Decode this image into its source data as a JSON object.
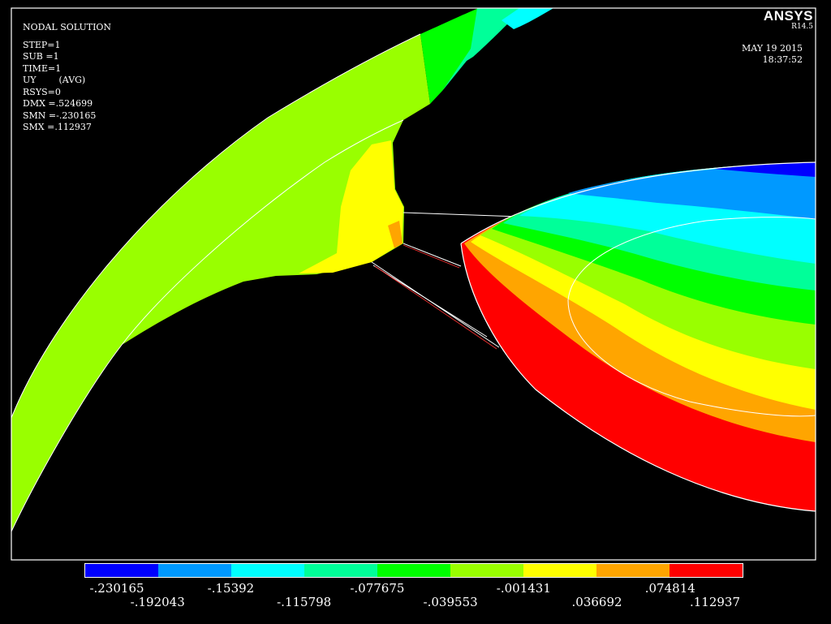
{
  "info": {
    "title": "NODAL SOLUTION",
    "step": "STEP=1",
    "sub": "SUB =1",
    "time": "TIME=1",
    "result": "UY        (AVG)",
    "rsys": "RSYS=0",
    "dmx": "DMX =.524699",
    "smn": "SMN =-.230165",
    "smx": "SMX =.112937"
  },
  "brand": {
    "name": "ANSYS",
    "release": "R14.5"
  },
  "stamp": {
    "date": "MAY 19 2015",
    "time": "18:37:52"
  },
  "legend": {
    "colors": [
      "#0000ff",
      "#0099ff",
      "#00ffff",
      "#00ff99",
      "#00ff00",
      "#99ff00",
      "#ffff00",
      "#ffa500",
      "#ff0000"
    ],
    "labels": [
      "-.230165",
      "-.192043",
      "-.15392",
      "-.115798",
      "-.077675",
      "-.039553",
      "-.001431",
      ".036692",
      ".074814",
      ".112937"
    ]
  },
  "colors": {
    "background": "#000000",
    "border": "#ffffff"
  }
}
